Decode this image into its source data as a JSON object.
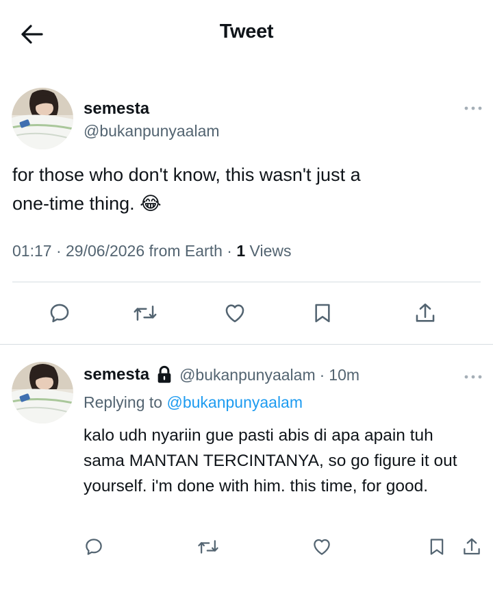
{
  "header": {
    "title": "Tweet"
  },
  "tweet": {
    "name": "semesta",
    "handle": "@bukanpunyaalam",
    "text_line1": "for those who don't know, this wasn't just a",
    "text_line2": "one-time thing.",
    "emoji": "😂",
    "time": "01:17",
    "date": "29/06/2026",
    "location": "from Earth",
    "views_count": "1",
    "views_label": "Views"
  },
  "reply": {
    "name": "semesta",
    "handle": "@bukanpunyaalam",
    "age": "10m",
    "replying_prefix": "Replying to",
    "replying_handle": "@bukanpunyaalam",
    "text": "kalo udh nyariin gue pasti abis di apa apain tuh sama MANTAN TERCINTANYA, so go figure it out yourself. i'm done with him. this time, for good."
  },
  "colors": {
    "accent": "#1d9bf0",
    "text": "#0f1419",
    "secondary": "#536471",
    "divider": "#d6dde2"
  },
  "icons": [
    "back-arrow-icon",
    "more-icon",
    "reply-icon",
    "retweet-icon",
    "like-icon",
    "bookmark-icon",
    "share-icon",
    "lock-icon"
  ]
}
